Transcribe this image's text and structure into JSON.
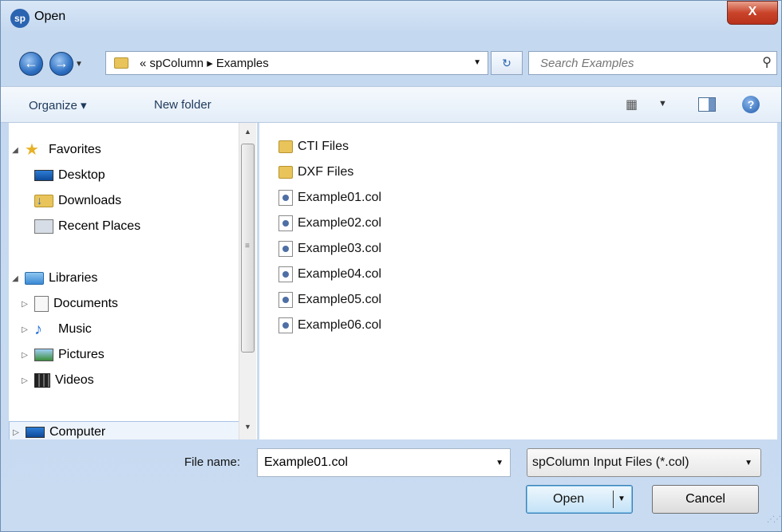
{
  "window": {
    "title": "Open",
    "app_icon_text": "sp",
    "close_label": "X"
  },
  "address_bar": {
    "path_text": "« spColumn ▸ Examples",
    "back_glyph": "←",
    "forward_glyph": "→"
  },
  "search": {
    "placeholder": "Search Examples"
  },
  "toolbar": {
    "organize_label": "Organize ▾",
    "new_folder_label": "New folder",
    "help_glyph": "?"
  },
  "nav_pane": {
    "favorites": {
      "label": "Favorites",
      "items": [
        {
          "label": "Desktop",
          "icon": "desktop-icon"
        },
        {
          "label": "Downloads",
          "icon": "downloads-icon"
        },
        {
          "label": "Recent Places",
          "icon": "recent-places-icon"
        }
      ]
    },
    "libraries": {
      "label": "Libraries",
      "items": [
        {
          "label": "Documents",
          "icon": "documents-icon"
        },
        {
          "label": "Music",
          "icon": "music-icon"
        },
        {
          "label": "Pictures",
          "icon": "pictures-icon"
        },
        {
          "label": "Videos",
          "icon": "videos-icon"
        }
      ]
    },
    "computer": {
      "label": "Computer"
    }
  },
  "files": [
    {
      "name": "CTI Files",
      "type": "folder"
    },
    {
      "name": "DXF Files",
      "type": "folder"
    },
    {
      "name": "Example01.col",
      "type": "col"
    },
    {
      "name": "Example02.col",
      "type": "col"
    },
    {
      "name": "Example03.col",
      "type": "col"
    },
    {
      "name": "Example04.col",
      "type": "col"
    },
    {
      "name": "Example05.col",
      "type": "col"
    },
    {
      "name": "Example06.col",
      "type": "col"
    }
  ],
  "bottom": {
    "file_name_label": "File name:",
    "file_name_value": "Example01.col",
    "file_type_value": "spColumn Input Files (*.col)",
    "open_label": "Open",
    "cancel_label": "Cancel"
  }
}
